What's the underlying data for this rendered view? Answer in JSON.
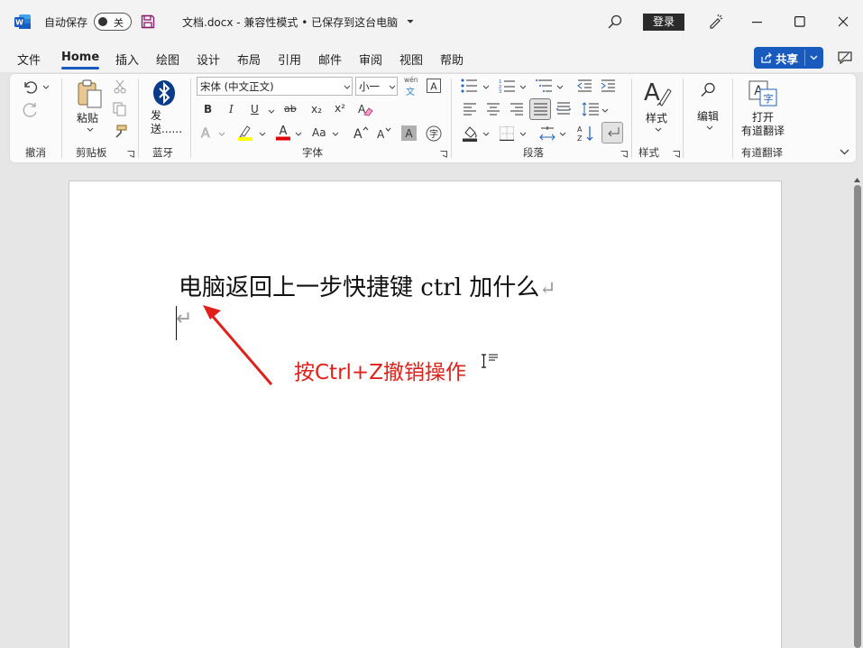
{
  "titlebar": {
    "autosave_label": "自动保存",
    "autosave_toggle": "关",
    "document_title": "文档.docx  -  兼容性模式 • 已保存到这台电脑",
    "login_label": "登录"
  },
  "menu": {
    "tabs": [
      "文件",
      "Home",
      "插入",
      "绘图",
      "设计",
      "布局",
      "引用",
      "邮件",
      "审阅",
      "视图",
      "帮助"
    ],
    "active_tab": "Home",
    "share_label": "共享"
  },
  "ribbon": {
    "undo_group": "撤消",
    "clipboard_group": "剪贴板",
    "paste_label": "粘贴",
    "bluetooth_group": "蓝牙",
    "bluetooth_button": "发送......",
    "font_group": "字体",
    "font_name": "宋体 (中文正文)",
    "font_size": "小一",
    "paragraph_group": "段落",
    "styles_group": "样式",
    "styles_label": "样式",
    "editing_label": "编辑",
    "youdao_group": "有道翻译",
    "youdao_button_line1": "打开",
    "youdao_button_line2": "有道翻译",
    "font_buttons": [
      "B",
      "I",
      "U",
      "ab",
      "x₂",
      "x²",
      "Aa"
    ],
    "wen_label": "wén"
  },
  "document": {
    "line1": "电脑返回上一步快捷键 ctrl 加什么",
    "paragraph_mark": "↵"
  },
  "annotation": {
    "text": "按Ctrl+Z撤销操作",
    "color": "#e0201a"
  },
  "colors": {
    "accent": "#185abd",
    "highlight": "#ffff00",
    "font_color": "#e00000"
  }
}
